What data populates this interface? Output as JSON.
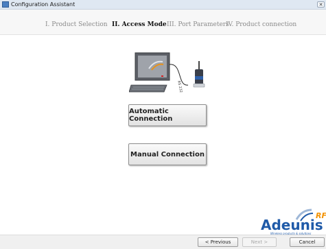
{
  "window": {
    "title": "Configuration Assistant",
    "close_glyph": "✕"
  },
  "steps": [
    {
      "label": "I. Product Selection"
    },
    {
      "label": "II. Access Mode"
    },
    {
      "label": "III. Port Parameters"
    },
    {
      "label": "IV. Product connection"
    }
  ],
  "illustration": {
    "cable_label": "RS 232"
  },
  "buttons": {
    "automatic": "Automatic Connection",
    "manual": "Manual Connection"
  },
  "logo": {
    "brand": "Adeunis",
    "superscript": "RF",
    "tagline": "Wireless products & solutions"
  },
  "footer": {
    "previous": "< Previous",
    "next": "Next >",
    "cancel": "Cancel"
  },
  "colors": {
    "accent": "#4a7fc1",
    "brand_blue": "#1f5aa8",
    "brand_orange": "#f39200"
  }
}
